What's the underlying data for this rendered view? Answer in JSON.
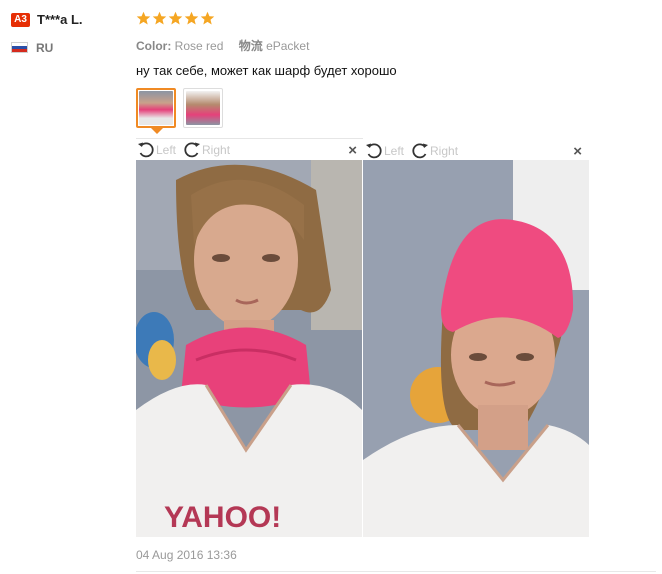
{
  "user": {
    "badge": "A3",
    "name": "T***a L.",
    "country": "RU"
  },
  "rating": {
    "stars": 5,
    "color": "#f5a623"
  },
  "attributes": [
    {
      "key": "Color:",
      "value": "Rose red"
    },
    {
      "key": "物流",
      "value": "ePacket"
    }
  ],
  "review_text": "ну так себе, может как шарф будет хорошо",
  "thumbnails": [
    {
      "name": "photo-thumbnail-1",
      "selected": true
    },
    {
      "name": "photo-thumbnail-2",
      "selected": false
    }
  ],
  "viewer": {
    "rotate_left": "Left",
    "rotate_right": "Right",
    "close_label": "×",
    "icons": [
      "rotate-left-icon",
      "rotate-right-icon",
      "close-icon"
    ]
  },
  "photos": [
    {
      "shirt_text": "YAHOO!",
      "product_color": "#e8417a"
    },
    {
      "product_color": "#ef4b80"
    }
  ],
  "date": "04 Aug 2016 13:36",
  "colors": {
    "accent": "#f08a24",
    "badge": "#e62e04",
    "product": "#e8417a"
  }
}
